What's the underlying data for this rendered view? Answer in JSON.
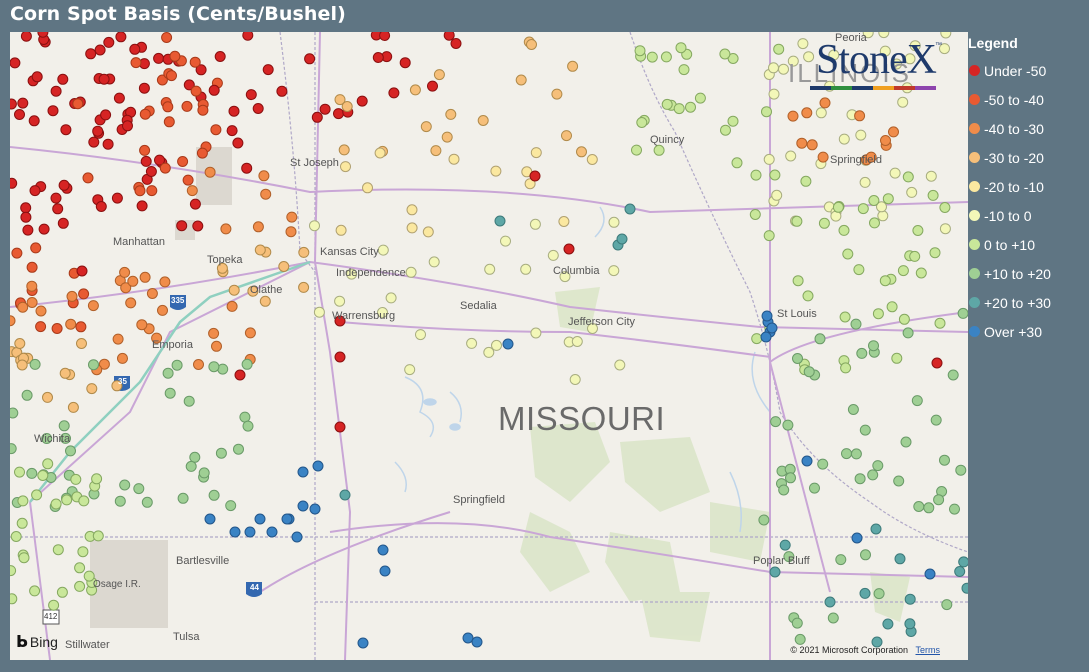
{
  "title": "Corn Spot Basis (Cents/Bushel)",
  "legend": {
    "title": "Legend",
    "items": [
      {
        "label": "Under -50",
        "color": "#d62424"
      },
      {
        "label": "-50 to -40",
        "color": "#e85a32"
      },
      {
        "label": "-40 to -30",
        "color": "#f08c4a"
      },
      {
        "label": "-30 to -20",
        "color": "#f6bf7a"
      },
      {
        "label": "-20 to -10",
        "color": "#fbe8a0"
      },
      {
        "label": "-10 to 0",
        "color": "#f3f7b8"
      },
      {
        "label": "0 to +10",
        "color": "#c9e79a"
      },
      {
        "label": "+10 to +20",
        "color": "#9fcf94"
      },
      {
        "label": "+20 to +30",
        "color": "#5ea7a6"
      },
      {
        "label": "Over +30",
        "color": "#3a83c4"
      }
    ]
  },
  "logo": {
    "text": "StoneX",
    "tm": "™",
    "bar_colors": [
      "#1e3a6b",
      "#2f8f3e",
      "#1e3a6b",
      "#f0a020",
      "#c0392b",
      "#8e44ad"
    ]
  },
  "map": {
    "state_label": "MISSOURI",
    "cities": [
      {
        "name": "St Joseph"
      },
      {
        "name": "Manhattan"
      },
      {
        "name": "Topeka"
      },
      {
        "name": "Kansas City"
      },
      {
        "name": "Independence"
      },
      {
        "name": "Olathe"
      },
      {
        "name": "Columbia"
      },
      {
        "name": "Sedalia"
      },
      {
        "name": "Warrensburg"
      },
      {
        "name": "Jefferson City"
      },
      {
        "name": "St Louis"
      },
      {
        "name": "Emporia"
      },
      {
        "name": "Wichita"
      },
      {
        "name": "Springfield"
      },
      {
        "name": "Bartlesville"
      },
      {
        "name": "Osage I.R."
      },
      {
        "name": "Poplar Bluff"
      },
      {
        "name": "Tulsa"
      },
      {
        "name": "Stillwater"
      },
      {
        "name": "Quincy"
      },
      {
        "name": "Peoria"
      },
      {
        "name": "ILLINOIS"
      }
    ],
    "springfield_il": "Springfield",
    "highways": [
      "335",
      "35",
      "44",
      "412"
    ],
    "attribution": "© 2021 Microsoft Corporation",
    "terms": "Terms",
    "provider": "Bing"
  }
}
